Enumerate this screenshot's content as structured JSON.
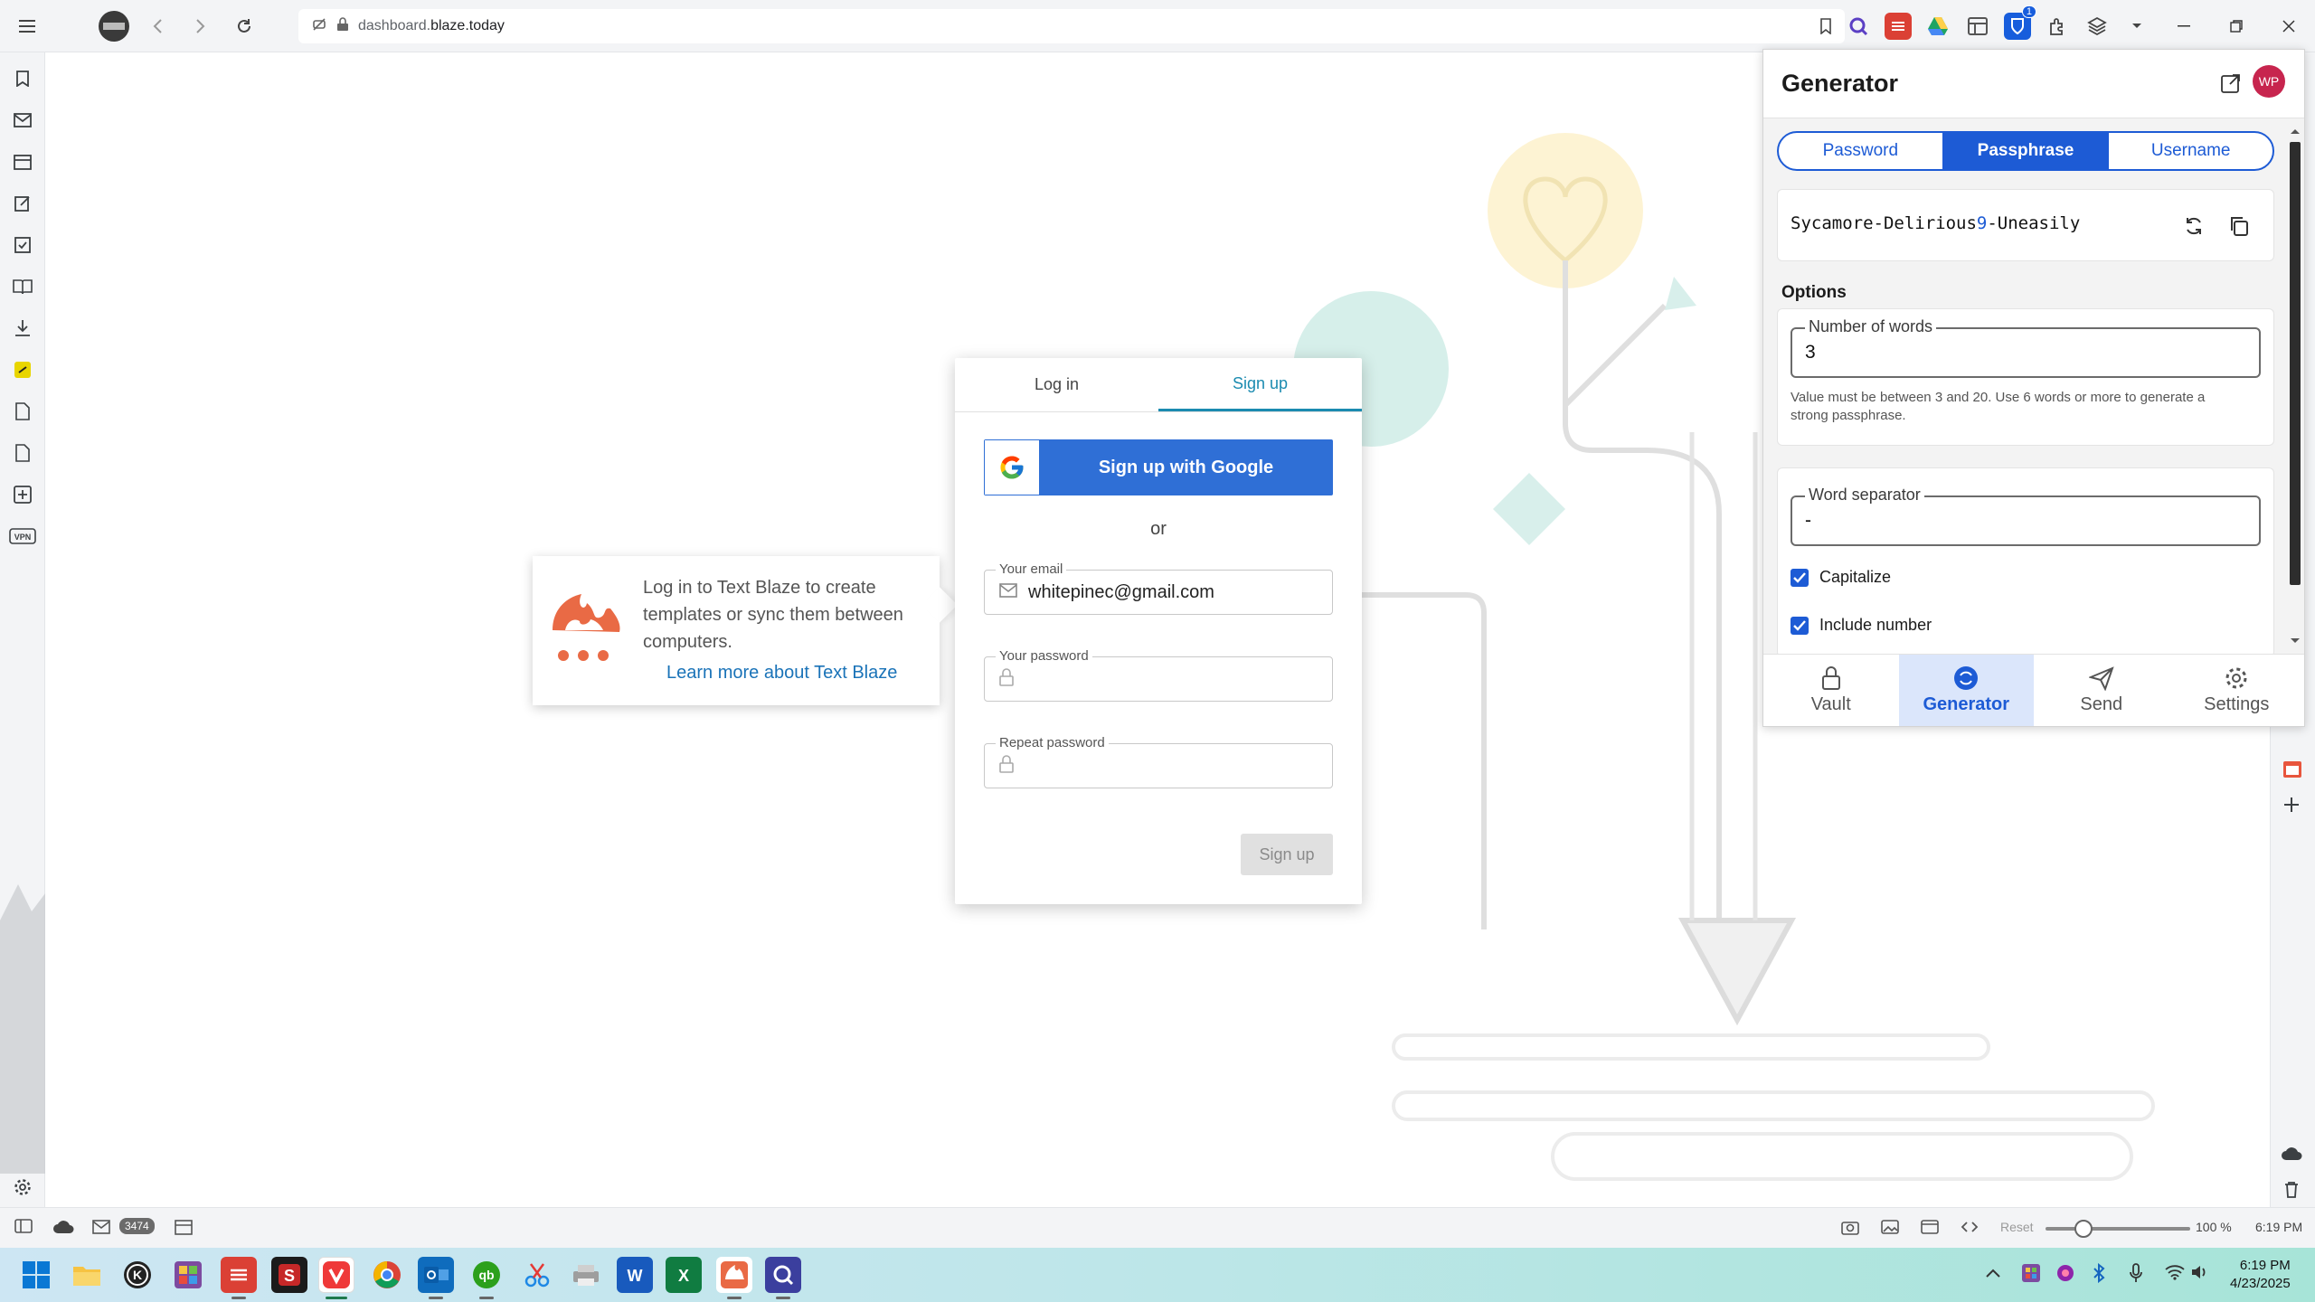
{
  "browser": {
    "url_prefix": "dashboard.",
    "url_domain": "blaze.today",
    "extension_badge": "1"
  },
  "login": {
    "tabs": [
      {
        "label": "Log in",
        "active": false
      },
      {
        "label": "Sign up",
        "active": true
      }
    ],
    "google_button_label": "Sign up with Google",
    "or_text": "or",
    "email_label": "Your email",
    "email_value": "whitepinec@gmail.com",
    "password_label": "Your password",
    "repeat_password_label": "Repeat password",
    "submit_label": "Sign up"
  },
  "tooltip": {
    "text": "Log in to Text Blaze to create templates or sync them between computers.",
    "link": "Learn more about Text Blaze"
  },
  "generator": {
    "title": "Generator",
    "avatar_initials": "WP",
    "types": [
      {
        "label": "Password",
        "active": false
      },
      {
        "label": "Passphrase",
        "active": true
      },
      {
        "label": "Username",
        "active": false
      }
    ],
    "passphrase_part1": "Sycamore-Delirious",
    "passphrase_num": "9",
    "passphrase_part2": "-Uneasily",
    "options_label": "Options",
    "num_words_label": "Number of words",
    "num_words_value": "3",
    "num_words_hint": "Value must be between 3 and 20. Use 6 words or more to generate a strong passphrase.",
    "separator_label": "Word separator",
    "separator_value": "-",
    "capitalize_label": "Capitalize",
    "include_number_label": "Include number",
    "nav": [
      {
        "label": "Vault",
        "icon": "lock-icon",
        "active": false
      },
      {
        "label": "Generator",
        "icon": "refresh-icon",
        "active": true
      },
      {
        "label": "Send",
        "icon": "send-icon",
        "active": false
      },
      {
        "label": "Settings",
        "icon": "gear-icon",
        "active": false
      }
    ],
    "accent_color": "#1d5bd5"
  },
  "statusbar": {
    "mail_count": "3474",
    "reset_label": "Reset",
    "zoom": "100 %",
    "time": "6:19 PM"
  },
  "taskbar": {
    "time": "6:19 PM",
    "date": "4/23/2025"
  }
}
